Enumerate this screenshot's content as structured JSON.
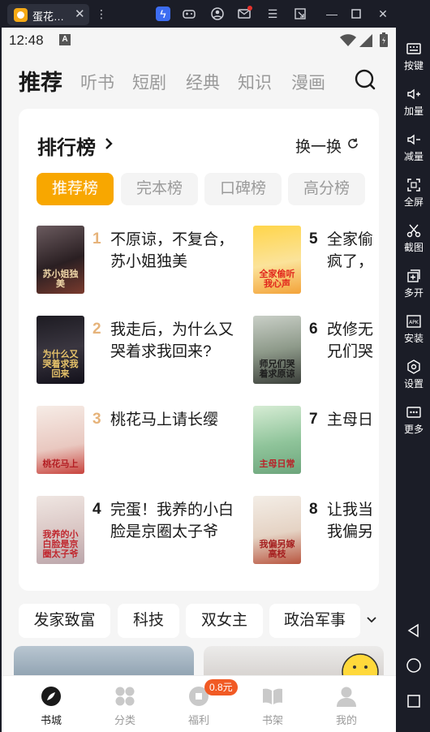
{
  "emulator": {
    "tab_title": "蛋花…",
    "sidebar": [
      {
        "label": "按键",
        "icon": "keyboard-icon"
      },
      {
        "label": "加量",
        "icon": "volume-up-icon"
      },
      {
        "label": "减量",
        "icon": "volume-down-icon"
      },
      {
        "label": "全屏",
        "icon": "fullscreen-icon"
      },
      {
        "label": "截图",
        "icon": "scissors-icon"
      },
      {
        "label": "多开",
        "icon": "multi-instance-icon"
      },
      {
        "label": "安装",
        "icon": "apk-install-icon"
      },
      {
        "label": "设置",
        "icon": "settings-icon"
      },
      {
        "label": "更多",
        "icon": "more-icon"
      }
    ]
  },
  "status": {
    "time": "12:48"
  },
  "top_nav": {
    "tabs": [
      {
        "label": "推荐",
        "active": true
      },
      {
        "label": "听书"
      },
      {
        "label": "短剧"
      },
      {
        "label": "经典"
      },
      {
        "label": "知识"
      },
      {
        "label": "漫画"
      }
    ]
  },
  "ranking": {
    "title": "排行榜",
    "swap_label": "换一换",
    "pills": [
      {
        "label": "推荐榜",
        "active": true
      },
      {
        "label": "完本榜"
      },
      {
        "label": "口碑榜"
      },
      {
        "label": "高分榜"
      }
    ],
    "books": [
      {
        "rank": "1",
        "line1": "不原谅，不复合，",
        "line2": "苏小姐独美",
        "cover_text": "苏小姐独美",
        "rank_color": "#e6b37a"
      },
      {
        "rank": "2",
        "line1": "我走后，为什么又",
        "line2": "哭着求我回来?",
        "cover_text": "为什么又哭着求我回来",
        "rank_color": "#e6b37a"
      },
      {
        "rank": "3",
        "line1": "桃花马上请长缨",
        "line2": "",
        "cover_text": "桃花马上",
        "rank_color": "#e6b37a"
      },
      {
        "rank": "4",
        "line1": "完蛋！我养的小白",
        "line2": "脸是京圈太子爷",
        "cover_text": "我养的小白脸是京圈太子爷",
        "rank_color": "#1a1a1a"
      },
      {
        "rank": "5",
        "line1": "全家偷",
        "line2": "疯了，",
        "cover_text": "全家偷听我心声",
        "rank_color": "#1a1a1a"
      },
      {
        "rank": "6",
        "line1": "改修无",
        "line2": "兄们哭",
        "cover_text": "师兄们哭着求原谅",
        "rank_color": "#1a1a1a"
      },
      {
        "rank": "7",
        "line1": "主母日",
        "line2": "",
        "cover_text": "主母日常",
        "rank_color": "#1a1a1a"
      },
      {
        "rank": "8",
        "line1": "让我当",
        "line2": "我偏另",
        "cover_text": "我偏另嫁高枝",
        "rank_color": "#1a1a1a"
      }
    ]
  },
  "categories": [
    "发家致富",
    "科技",
    "双女主",
    "政治军事"
  ],
  "bottom_nav": {
    "items": [
      {
        "label": "书城",
        "active": true
      },
      {
        "label": "分类"
      },
      {
        "label": "福利"
      },
      {
        "label": "书架"
      },
      {
        "label": "我的"
      }
    ],
    "welfare_badge": "0.8元"
  }
}
